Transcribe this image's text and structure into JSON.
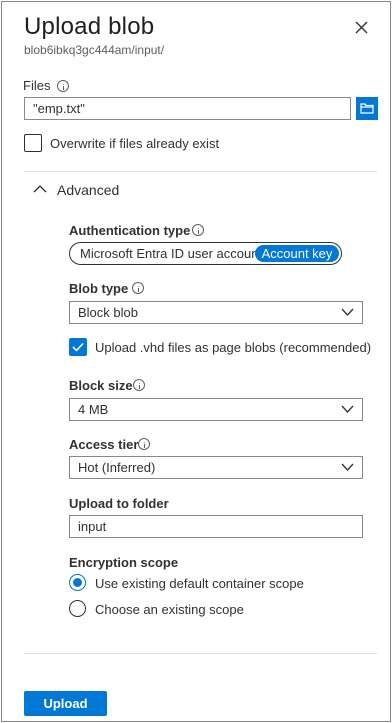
{
  "panel": {
    "title": "Upload blob",
    "subtitle": "blob6ibkq3gc444am/input/"
  },
  "files": {
    "label": "Files",
    "value": "\"emp.txt\"",
    "browse_icon": "folder-icon"
  },
  "overwrite": {
    "label": "Overwrite if files already exist",
    "checked": false
  },
  "advanced": {
    "label": "Advanced",
    "expanded": true
  },
  "auth_type": {
    "label": "Authentication type",
    "option1": "Microsoft Entra ID user account",
    "option2": "Account key",
    "selected": "Account key"
  },
  "blob_type": {
    "label": "Blob type",
    "value": "Block blob"
  },
  "vhd_option": {
    "label": "Upload .vhd files as page blobs (recommended)",
    "checked": true
  },
  "block_size": {
    "label": "Block size",
    "value": "4 MB"
  },
  "access_tier": {
    "label": "Access tier",
    "value": "Hot (Inferred)"
  },
  "upload_folder": {
    "label": "Upload to folder",
    "value": "input"
  },
  "encryption": {
    "label": "Encryption scope",
    "option1": "Use existing default container scope",
    "option2": "Choose an existing scope",
    "selected": "Use existing default container scope"
  },
  "footer": {
    "upload_label": "Upload"
  },
  "colors": {
    "accent": "#0078d4",
    "border": "#8a8886",
    "text": "#323130"
  }
}
